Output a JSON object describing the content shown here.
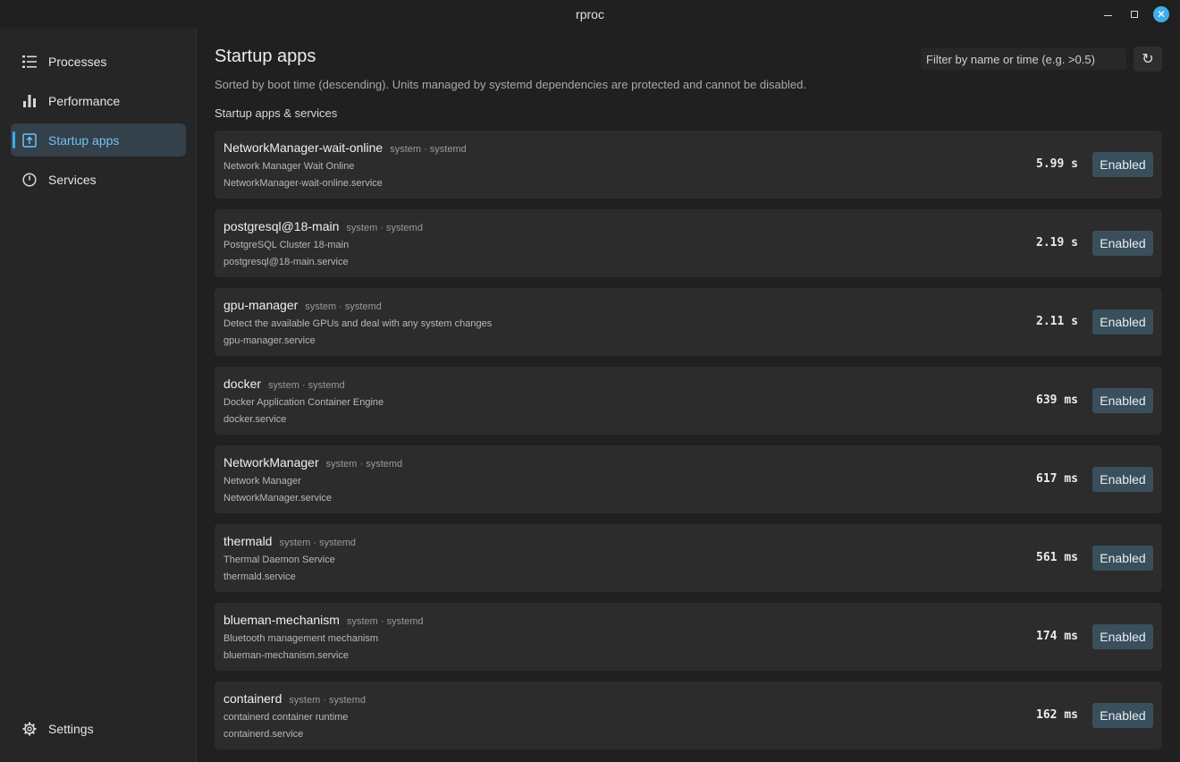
{
  "window": {
    "title": "rproc"
  },
  "sidebar": {
    "items": [
      {
        "label": "Processes",
        "icon": "list-icon"
      },
      {
        "label": "Performance",
        "icon": "bar-chart-icon"
      },
      {
        "label": "Startup apps",
        "icon": "startup-icon"
      },
      {
        "label": "Services",
        "icon": "power-icon"
      }
    ],
    "settings_label": "Settings",
    "accent": "#3daee9"
  },
  "main": {
    "title": "Startup apps",
    "subtitle": "Sorted by boot time (descending). Units managed by systemd dependencies are protected and cannot be disabled.",
    "section_label": "Startup apps & services",
    "filter_placeholder": "Filter by name or time (e.g. >0.5)",
    "refresh_glyph": "↻",
    "apps": [
      {
        "name": "NetworkManager-wait-online",
        "meta": "system · systemd",
        "desc": "Network Manager Wait Online",
        "unit": "NetworkManager-wait-online.service",
        "time": "5.99 s",
        "state": "Enabled"
      },
      {
        "name": "postgresql@18-main",
        "meta": "system · systemd",
        "desc": "PostgreSQL Cluster 18-main",
        "unit": "postgresql@18-main.service",
        "time": "2.19 s",
        "state": "Enabled"
      },
      {
        "name": "gpu-manager",
        "meta": "system · systemd",
        "desc": "Detect the available GPUs and deal with any system changes",
        "unit": "gpu-manager.service",
        "time": "2.11 s",
        "state": "Enabled"
      },
      {
        "name": "docker",
        "meta": "system · systemd",
        "desc": "Docker Application Container Engine",
        "unit": "docker.service",
        "time": "639 ms",
        "state": "Enabled"
      },
      {
        "name": "NetworkManager",
        "meta": "system · systemd",
        "desc": "Network Manager",
        "unit": "NetworkManager.service",
        "time": "617 ms",
        "state": "Enabled"
      },
      {
        "name": "thermald",
        "meta": "system · systemd",
        "desc": "Thermal Daemon Service",
        "unit": "thermald.service",
        "time": "561 ms",
        "state": "Enabled"
      },
      {
        "name": "blueman-mechanism",
        "meta": "system · systemd",
        "desc": "Bluetooth management mechanism",
        "unit": "blueman-mechanism.service",
        "time": "174 ms",
        "state": "Enabled"
      },
      {
        "name": "containerd",
        "meta": "system · systemd",
        "desc": "containerd container runtime",
        "unit": "containerd.service",
        "time": "162 ms",
        "state": "Enabled"
      }
    ]
  }
}
